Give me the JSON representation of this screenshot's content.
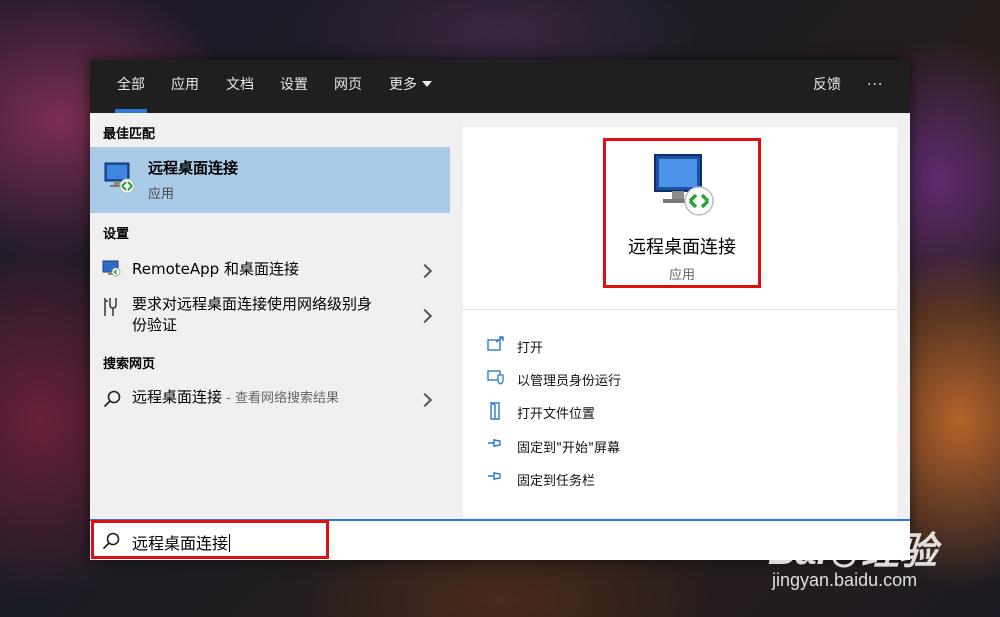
{
  "tabs": [
    {
      "label": "全部",
      "active": true
    },
    {
      "label": "应用"
    },
    {
      "label": "文档"
    },
    {
      "label": "设置"
    },
    {
      "label": "网页"
    },
    {
      "label": "更多"
    }
  ],
  "header_right": {
    "feedback_label": "反馈",
    "more_label": "···"
  },
  "left": {
    "best_match_heading": "最佳匹配",
    "best_match": {
      "title": "远程桌面连接",
      "subtitle": "应用"
    },
    "settings_heading": "设置",
    "settings_items": [
      {
        "label": "RemoteApp 和桌面连接"
      },
      {
        "label_line1": "要求对远程桌面连接使用网络级别身",
        "label_line2": "份验证"
      }
    ],
    "web_heading": "搜索网页",
    "web_item": {
      "label": "远程桌面连接",
      "suffix": " - 查看网络搜索结果"
    }
  },
  "preview": {
    "title": "远程桌面连接",
    "subtitle": "应用",
    "actions": [
      {
        "label": "打开",
        "icon": "open-icon"
      },
      {
        "label": "以管理员身份运行",
        "icon": "shield-icon"
      },
      {
        "label": "打开文件位置",
        "icon": "folder-icon"
      },
      {
        "label": "固定到\"开始\"屏幕",
        "icon": "pin-icon"
      },
      {
        "label": "固定到任务栏",
        "icon": "pin-icon"
      }
    ]
  },
  "search": {
    "value": "远程桌面连接"
  },
  "watermark": {
    "brand_left": "Bai",
    "brand_cn": "经验",
    "url": "jingyan.baidu.com"
  },
  "colors": {
    "accent": "#2b7bd6",
    "selection": "#aacbe8",
    "highlight": "#e01010",
    "tabbar": "#1f1f1f"
  }
}
